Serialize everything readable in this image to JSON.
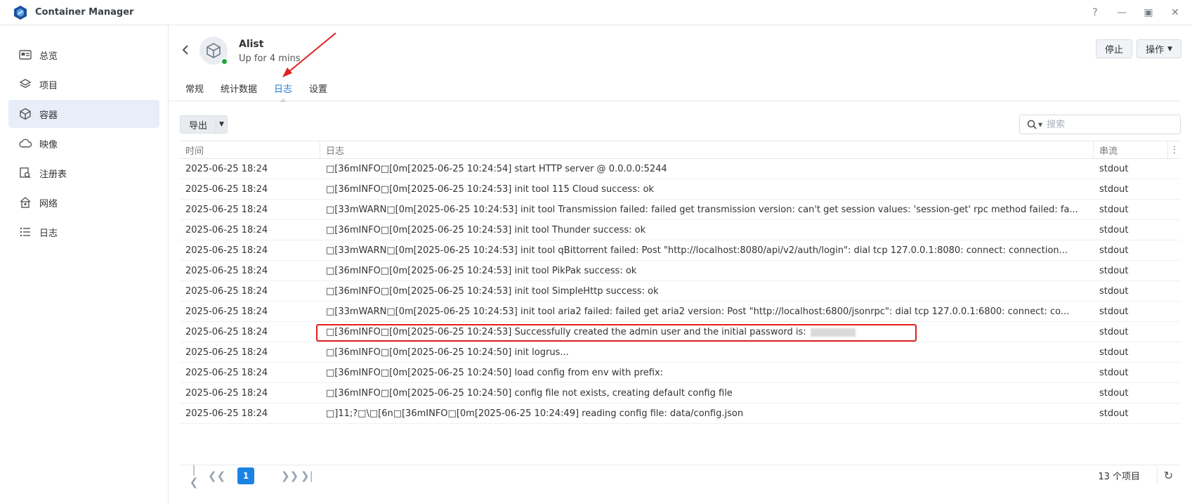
{
  "app": {
    "title": "Container Manager"
  },
  "window_controls": {
    "help": "?",
    "minimize": "—",
    "maximize": "▣",
    "close": "✕"
  },
  "sidebar": {
    "items": [
      {
        "label": "总览",
        "icon": "overview-icon"
      },
      {
        "label": "项目",
        "icon": "layers-icon"
      },
      {
        "label": "容器",
        "icon": "cube-icon",
        "active": true
      },
      {
        "label": "映像",
        "icon": "cloud-icon"
      },
      {
        "label": "注册表",
        "icon": "registry-icon"
      },
      {
        "label": "网络",
        "icon": "network-icon"
      },
      {
        "label": "日志",
        "icon": "list-icon"
      }
    ]
  },
  "container": {
    "name": "Alist",
    "status": "Up for 4 mins"
  },
  "header_buttons": {
    "stop": "停止",
    "actions": "操作"
  },
  "tabs": [
    {
      "label": "常规"
    },
    {
      "label": "统计数据"
    },
    {
      "label": "日志",
      "active": true
    },
    {
      "label": "设置"
    }
  ],
  "toolbar": {
    "export": "导出",
    "search_placeholder": "搜索"
  },
  "table": {
    "columns": {
      "time": "时间",
      "log": "日志",
      "stream": "串流"
    },
    "rows": [
      {
        "time": "2025-06-25 18:24",
        "log": "□[36mINFO□[0m[2025-06-25 10:24:54] start HTTP server @ 0.0.0.0:5244",
        "stream": "stdout"
      },
      {
        "time": "2025-06-25 18:24",
        "log": "□[36mINFO□[0m[2025-06-25 10:24:53] init tool 115 Cloud success: ok",
        "stream": "stdout"
      },
      {
        "time": "2025-06-25 18:24",
        "log": "□[33mWARN□[0m[2025-06-25 10:24:53] init tool Transmission failed: failed get transmission version: can't get session values: 'session-get' rpc method failed: fa...",
        "stream": "stdout"
      },
      {
        "time": "2025-06-25 18:24",
        "log": "□[36mINFO□[0m[2025-06-25 10:24:53] init tool Thunder success: ok",
        "stream": "stdout"
      },
      {
        "time": "2025-06-25 18:24",
        "log": "□[33mWARN□[0m[2025-06-25 10:24:53] init tool qBittorrent failed: Post \"http://localhost:8080/api/v2/auth/login\": dial tcp 127.0.0.1:8080: connect: connection...",
        "stream": "stdout"
      },
      {
        "time": "2025-06-25 18:24",
        "log": "□[36mINFO□[0m[2025-06-25 10:24:53] init tool PikPak success: ok",
        "stream": "stdout"
      },
      {
        "time": "2025-06-25 18:24",
        "log": "□[36mINFO□[0m[2025-06-25 10:24:53] init tool SimpleHttp success: ok",
        "stream": "stdout"
      },
      {
        "time": "2025-06-25 18:24",
        "log": "□[33mWARN□[0m[2025-06-25 10:24:53] init tool aria2 failed: failed get aria2 version: Post \"http://localhost:6800/jsonrpc\": dial tcp 127.0.0.1:6800: connect: co...",
        "stream": "stdout"
      },
      {
        "time": "2025-06-25 18:24",
        "log": "□[36mINFO□[0m[2025-06-25 10:24:53] Successfully created the admin user and the initial password is:",
        "stream": "stdout",
        "redacted": true
      },
      {
        "time": "2025-06-25 18:24",
        "log": "□[36mINFO□[0m[2025-06-25 10:24:50] init logrus...",
        "stream": "stdout"
      },
      {
        "time": "2025-06-25 18:24",
        "log": "□[36mINFO□[0m[2025-06-25 10:24:50] load config from env with prefix:",
        "stream": "stdout"
      },
      {
        "time": "2025-06-25 18:24",
        "log": "□[36mINFO□[0m[2025-06-25 10:24:50] config file not exists, creating default config file",
        "stream": "stdout"
      },
      {
        "time": "2025-06-25 18:24",
        "log": "□]11;?□\\□[6n□[36mINFO□[0m[2025-06-25 10:24:49] reading config file: data/config.json",
        "stream": "stdout"
      }
    ]
  },
  "pagination": {
    "current_page": "1",
    "total": "13 个项目"
  },
  "colors": {
    "accent": "#1a83e5",
    "highlight": "#e02020",
    "status_running": "#21a53a"
  }
}
